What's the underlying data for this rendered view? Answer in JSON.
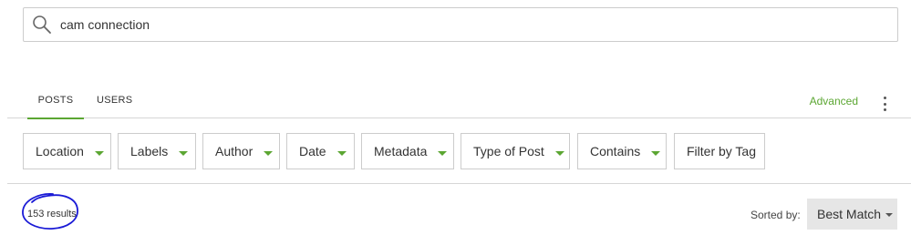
{
  "search": {
    "value": "cam connection",
    "icon": "search-icon"
  },
  "tabs": [
    {
      "label": "POSTS",
      "active": true
    },
    {
      "label": "USERS",
      "active": false
    }
  ],
  "advanced_label": "Advanced",
  "filters": [
    {
      "label": "Location",
      "has_caret": true
    },
    {
      "label": "Labels",
      "has_caret": true
    },
    {
      "label": "Author",
      "has_caret": true
    },
    {
      "label": "Date",
      "has_caret": true
    },
    {
      "label": "Metadata",
      "has_caret": true
    },
    {
      "label": "Type of Post",
      "has_caret": true
    },
    {
      "label": "Contains",
      "has_caret": true
    },
    {
      "label": "Filter by Tag",
      "has_caret": false
    }
  ],
  "results": {
    "count_text": "153 results"
  },
  "sort": {
    "label": "Sorted by:",
    "value": "Best Match"
  },
  "colors": {
    "accent": "#5ba632",
    "annotation": "#1a1ad6",
    "border": "#cccccc",
    "sort_bg": "#e6e6e6"
  }
}
